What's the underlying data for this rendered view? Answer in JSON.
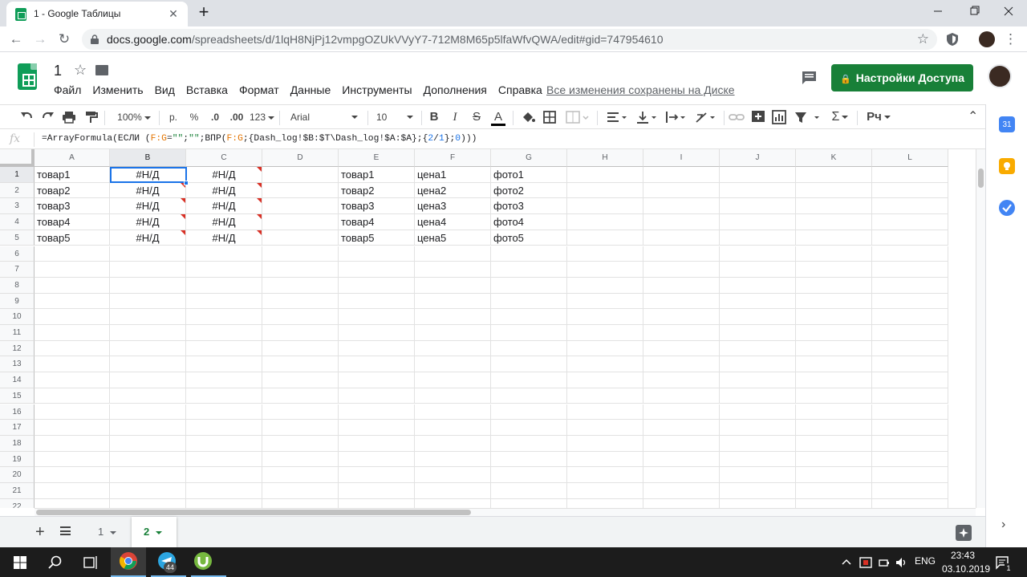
{
  "browser": {
    "tab_title": "1 - Google Таблицы",
    "url_host": "docs.google.com",
    "url_path": "/spreadsheets/d/1lqH8NjPj12vmpgOZUkVVyY7-712M8M65p5lfaWfvQWA/edit#gid=747954610",
    "new_tab": "+",
    "close": "✕",
    "minimize": "—",
    "maximize": "❐",
    "window_close": "✕",
    "back": "←",
    "forward": "→",
    "reload": "↻",
    "star": "☆",
    "menu": "⋮"
  },
  "doc": {
    "title": "1",
    "star": "☆",
    "menu": [
      "Файл",
      "Изменить",
      "Вид",
      "Вставка",
      "Формат",
      "Данные",
      "Инструменты",
      "Дополнения",
      "Справка"
    ],
    "save_status": "Все изменения сохранены на Диске",
    "share_label": "Настройки Доступа",
    "share_icon": "🔒"
  },
  "toolbar": {
    "zoom": "100%",
    "currency": "р.",
    "percent": "%",
    "dec_decrease": ".0",
    "dec_increase": ".00",
    "more_formats": "123",
    "font": "Arial",
    "font_size": "10",
    "bold": "B",
    "italic": "I",
    "strike": "S",
    "text_color": "A",
    "sigma": "Σ",
    "input_tools": "Рч",
    "collapse": "⌃"
  },
  "formula": {
    "fx": "fx",
    "parts": [
      {
        "t": "=ArrayFormula(ЕСЛИ (",
        "c": ""
      },
      {
        "t": "F:G",
        "c": "fr-orange"
      },
      {
        "t": "=",
        "c": ""
      },
      {
        "t": "\"\"",
        "c": "fr-green"
      },
      {
        "t": ";",
        "c": ""
      },
      {
        "t": "\"\"",
        "c": "fr-green"
      },
      {
        "t": ";ВПР(",
        "c": ""
      },
      {
        "t": "F:G",
        "c": "fr-orange"
      },
      {
        "t": ";{Dash_log!$B:$T\\Dash_log!$A:$A};{",
        "c": ""
      },
      {
        "t": "2",
        "c": "fr-blue"
      },
      {
        "t": "/",
        "c": ""
      },
      {
        "t": "1",
        "c": "fr-blue"
      },
      {
        "t": "};",
        "c": ""
      },
      {
        "t": "0",
        "c": "fr-blue"
      },
      {
        "t": ")))",
        "c": ""
      }
    ]
  },
  "grid": {
    "columns": [
      "A",
      "B",
      "C",
      "D",
      "E",
      "F",
      "G",
      "H",
      "I",
      "J",
      "K",
      "L"
    ],
    "rows": [
      "1",
      "2",
      "3",
      "4",
      "5",
      "6",
      "7",
      "8",
      "9",
      "10",
      "11",
      "12",
      "13",
      "14",
      "15",
      "16",
      "17",
      "18",
      "19",
      "20",
      "21",
      "22"
    ],
    "cells": [
      [
        "товар1",
        "#Н/Д",
        "#Н/Д",
        "",
        "товар1",
        "цена1",
        "фото1"
      ],
      [
        "товар2",
        "#Н/Д",
        "#Н/Д",
        "",
        "товар2",
        "цена2",
        "фото2"
      ],
      [
        "товар3",
        "#Н/Д",
        "#Н/Д",
        "",
        "товар3",
        "цена3",
        "фото3"
      ],
      [
        "товар4",
        "#Н/Д",
        "#Н/Д",
        "",
        "товар4",
        "цена4",
        "фото4"
      ],
      [
        "товар5",
        "#Н/Д",
        "#Н/Д",
        "",
        "товар5",
        "цена5",
        "фото5"
      ]
    ],
    "selected_cell": "B1"
  },
  "sheets": {
    "add": "+",
    "tabs": [
      {
        "label": "1",
        "active": false
      },
      {
        "label": "2",
        "active": true
      }
    ]
  },
  "side_panel": {
    "calendar_day": "31",
    "expand": "›"
  },
  "taskbar": {
    "lang": "ENG",
    "time": "23:43",
    "date": "03.10.2019",
    "telegram_badge": "44",
    "notif_badge": "1"
  },
  "colors": {
    "accent": "#1a73e8",
    "share": "#188038",
    "sheets_green": "#0f9d58",
    "error": "#d93025"
  }
}
